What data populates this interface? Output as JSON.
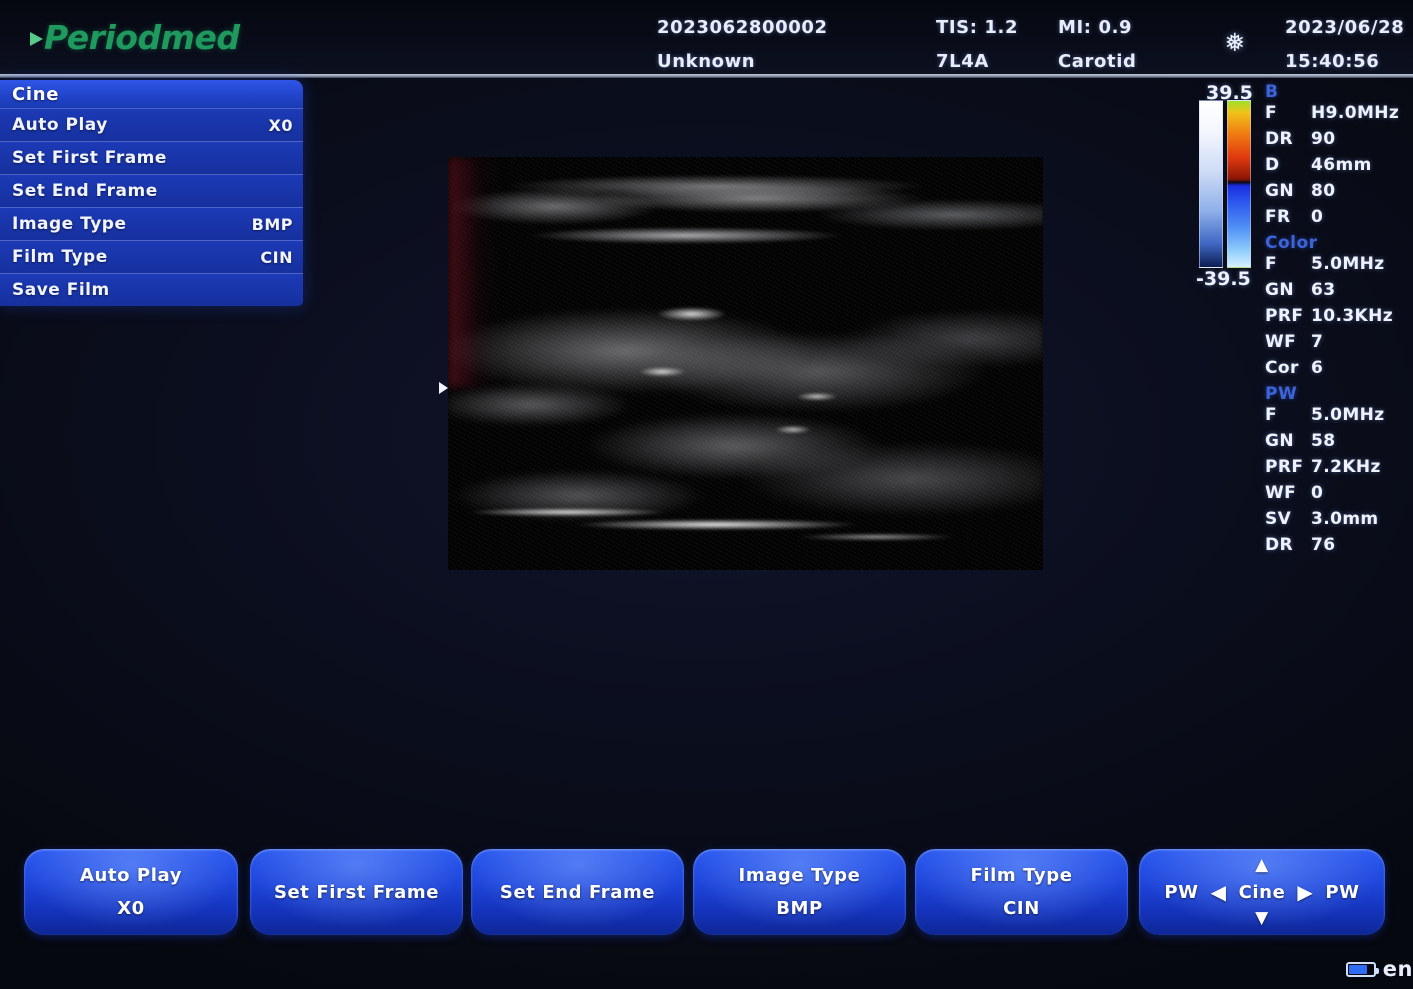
{
  "brand": {
    "name": "Periodmed",
    "color": "#1f9a5e"
  },
  "header": {
    "patient_id": "2023062800002",
    "patient_name": "Unknown",
    "tis": "TIS: 1.2",
    "probe": "7L4A",
    "mi": "MI: 0.9",
    "exam": "Carotid",
    "date": "2023/06/28",
    "time": "15:40:56",
    "freeze_icon": "snowflake-icon",
    "freeze_glyph": "❅"
  },
  "menu": {
    "title": "Cine",
    "items": [
      {
        "label": "Auto Play",
        "value": "X0"
      },
      {
        "label": "Set First Frame",
        "value": ""
      },
      {
        "label": "Set End Frame",
        "value": ""
      },
      {
        "label": "Image Type",
        "value": "BMP"
      },
      {
        "label": "Film Type",
        "value": "CIN"
      },
      {
        "label": "Save Film",
        "value": ""
      }
    ]
  },
  "colorbar": {
    "velocity_top": "39.5",
    "velocity_bottom": "-39.5"
  },
  "params": {
    "b": {
      "title": "B",
      "rows": [
        {
          "key": "F",
          "value": "H9.0MHz"
        },
        {
          "key": "DR",
          "value": "90"
        },
        {
          "key": "D",
          "value": "46mm"
        },
        {
          "key": "GN",
          "value": "80"
        },
        {
          "key": "FR",
          "value": "0"
        }
      ]
    },
    "color": {
      "title": "Color",
      "rows": [
        {
          "key": "F",
          "value": "5.0MHz"
        },
        {
          "key": "GN",
          "value": "63"
        },
        {
          "key": "PRF",
          "value": "10.3KHz"
        },
        {
          "key": "WF",
          "value": "7"
        },
        {
          "key": "Cor",
          "value": "6"
        }
      ]
    },
    "pw": {
      "title": "PW",
      "rows": [
        {
          "key": "F",
          "value": "5.0MHz"
        },
        {
          "key": "GN",
          "value": "58"
        },
        {
          "key": "PRF",
          "value": "7.2KHz"
        },
        {
          "key": "WF",
          "value": "0"
        },
        {
          "key": "SV",
          "value": "3.0mm"
        },
        {
          "key": "DR",
          "value": "76"
        }
      ]
    }
  },
  "buttons": [
    {
      "label": "Auto Play",
      "value": "X0"
    },
    {
      "label": "Set First Frame",
      "value": ""
    },
    {
      "label": "Set End Frame",
      "value": ""
    },
    {
      "label": "Image Type",
      "value": "BMP"
    },
    {
      "label": "Film Type",
      "value": "CIN"
    }
  ],
  "nav_button": {
    "left_label": "PW",
    "right_label": "PW",
    "center_label": "Cine",
    "up_glyph": "▲",
    "down_glyph": "▼",
    "left_glyph": "◀",
    "right_glyph": "▶"
  },
  "status": {
    "language": "en",
    "battery_icon": "battery-icon"
  }
}
